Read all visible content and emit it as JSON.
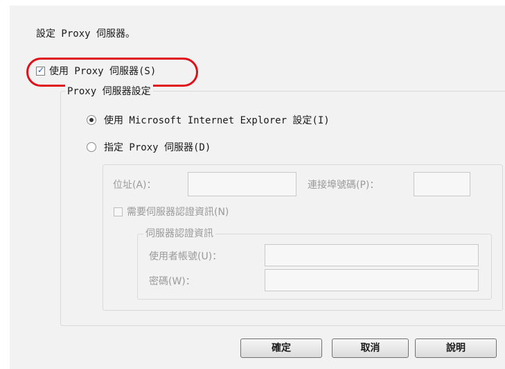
{
  "header": {
    "description": "設定 Proxy 伺服器。"
  },
  "use_proxy": {
    "label": "使用 Proxy 伺服器(S)",
    "checked": true
  },
  "proxy_settings": {
    "legend": "Proxy 伺服器設定",
    "use_ie_label": "使用 Microsoft Internet Explorer 設定(I)",
    "specify_label": "指定 Proxy 伺服器(D)",
    "address_label": "位址(A)：",
    "address_value": "",
    "port_label": "連接埠號碼(P)：",
    "port_value": "",
    "require_auth_label": "需要伺服器認證資訊(N)",
    "auth_group": {
      "legend": "伺服器認證資訊",
      "username_label": "使用者帳號(U)：",
      "username_value": "",
      "password_label": "密碼(W)：",
      "password_value": ""
    }
  },
  "buttons": {
    "ok": "確定",
    "cancel": "取消",
    "help": "說明"
  },
  "colors": {
    "highlight": "#e0101a",
    "dialog_bg": "#f2f2f2",
    "disabled_text": "#9a9a9a"
  }
}
